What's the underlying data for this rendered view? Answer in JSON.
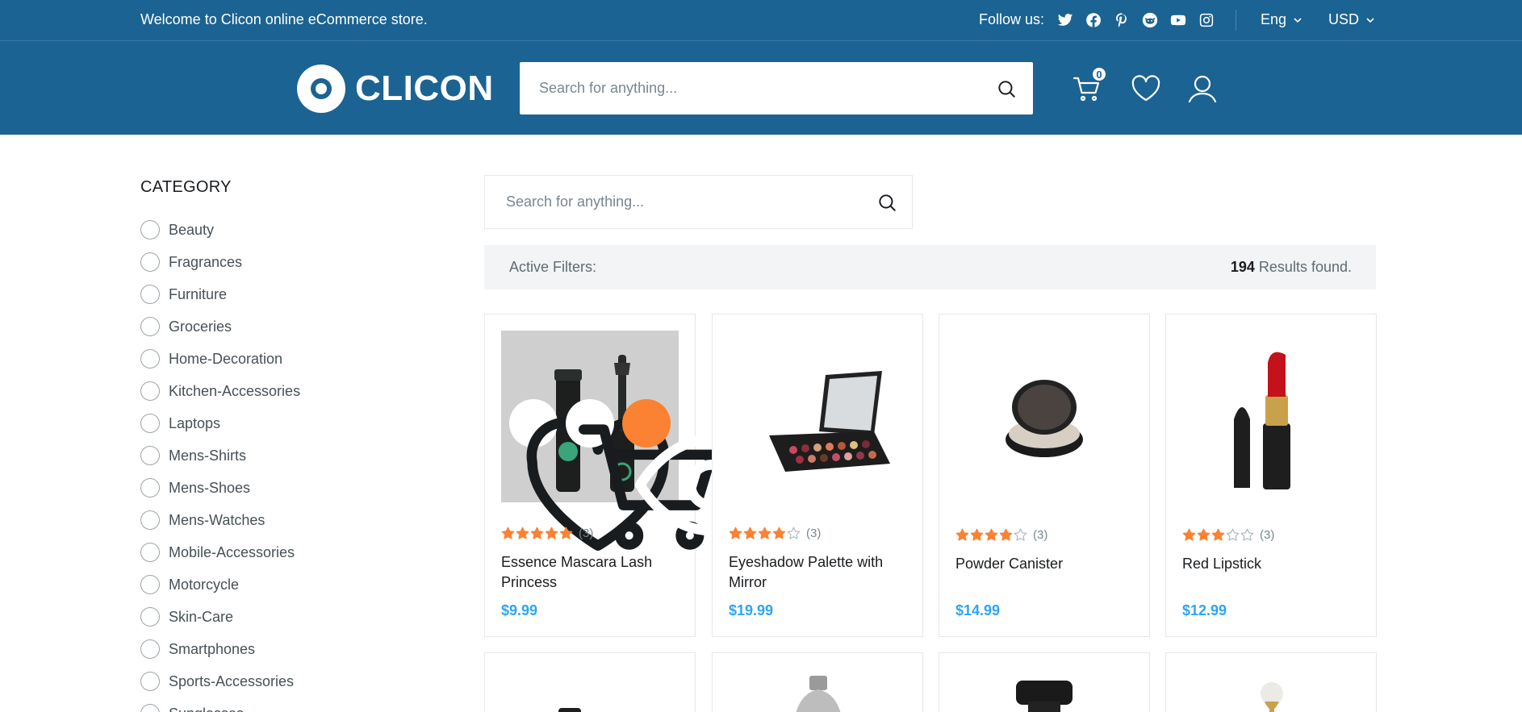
{
  "topbar": {
    "welcome": "Welcome to Clicon online eCommerce store.",
    "follow_label": "Follow us:",
    "social_icons": [
      "twitter-icon",
      "facebook-icon",
      "pinterest-icon",
      "reddit-icon",
      "youtube-icon",
      "instagram-icon"
    ],
    "language": "Eng",
    "currency": "USD"
  },
  "header": {
    "logo_text": "CLICON",
    "search_placeholder": "Search for anything...",
    "cart_count": "0"
  },
  "sidebar": {
    "title": "CATEGORY",
    "categories": [
      "Beauty",
      "Fragrances",
      "Furniture",
      "Groceries",
      "Home-Decoration",
      "Kitchen-Accessories",
      "Laptops",
      "Mens-Shirts",
      "Mens-Shoes",
      "Mens-Watches",
      "Mobile-Accessories",
      "Motorcycle",
      "Skin-Care",
      "Smartphones",
      "Sports-Accessories",
      "Sunglasses"
    ]
  },
  "main": {
    "search_placeholder": "Search for anything...",
    "active_filters_label": "Active Filters:",
    "results_count": "194",
    "results_label": " Results found."
  },
  "products": [
    {
      "title": "Essence Mascara Lash Princess",
      "price": "$9.99",
      "rating": 5,
      "reviews": "(3)"
    },
    {
      "title": "Eyeshadow Palette with Mirror",
      "price": "$19.99",
      "rating": 4,
      "reviews": "(3)"
    },
    {
      "title": "Powder Canister",
      "price": "$14.99",
      "rating": 4,
      "reviews": "(3)"
    },
    {
      "title": "Red Lipstick",
      "price": "$12.99",
      "rating": 3,
      "reviews": "(3)"
    }
  ],
  "colors": {
    "brand": "#1b6392",
    "accent": "#fa8232",
    "price": "#2da5f3",
    "star": "#fa8232"
  }
}
